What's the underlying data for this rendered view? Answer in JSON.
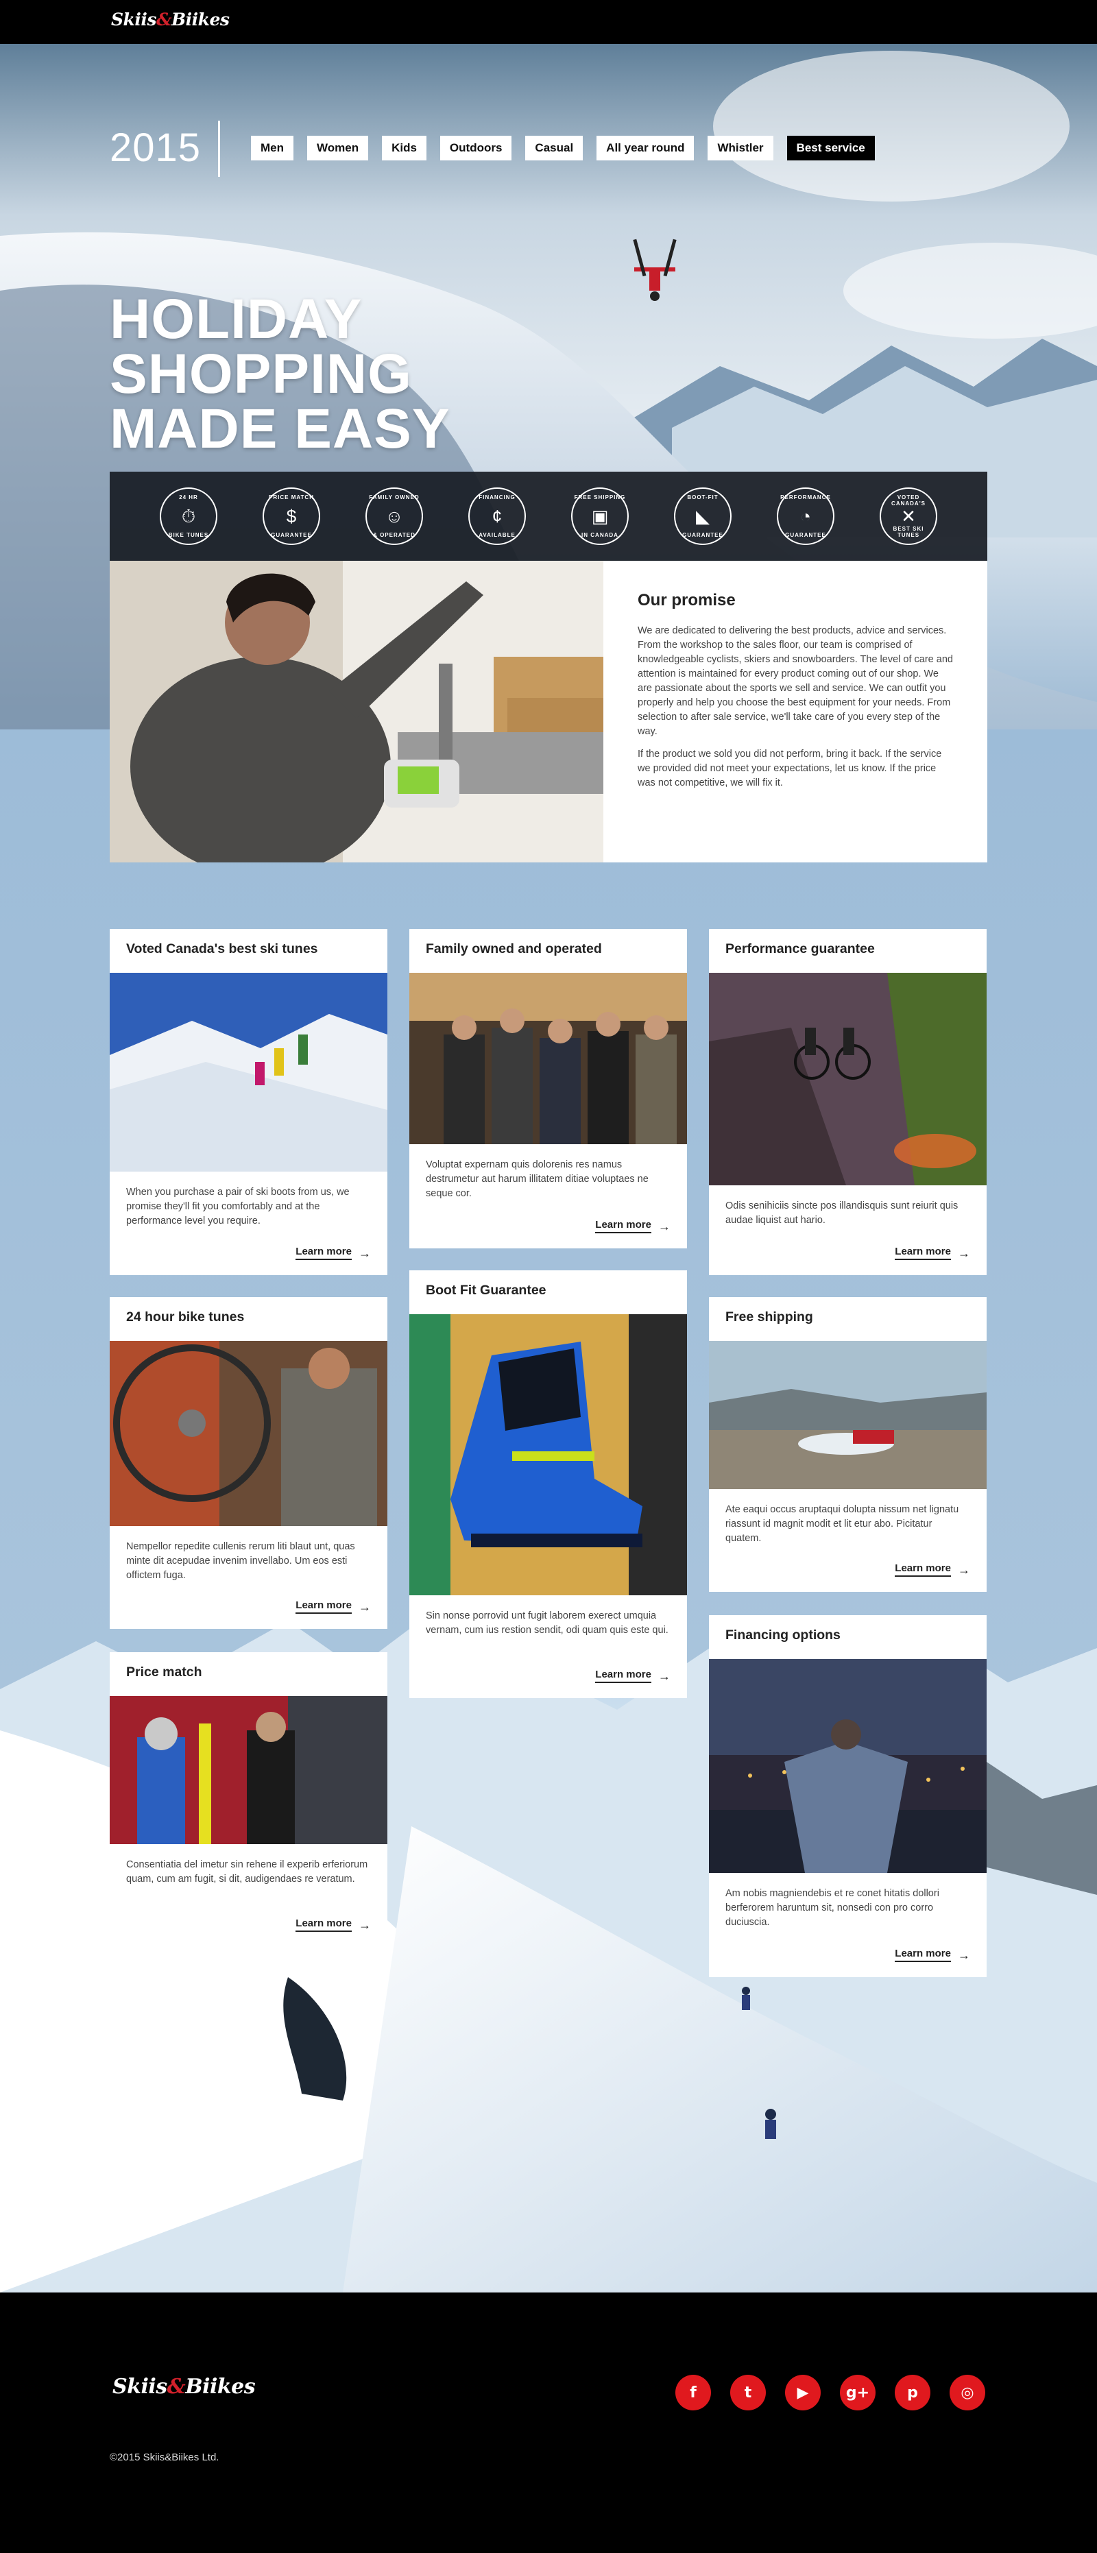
{
  "brand": {
    "logo_left": "Skiis",
    "logo_amp": "&",
    "logo_right": "Biikes"
  },
  "nav": {
    "year": "2015",
    "items": [
      {
        "label": "Men"
      },
      {
        "label": "Women"
      },
      {
        "label": "Kids"
      },
      {
        "label": "Outdoors"
      },
      {
        "label": "Casual"
      },
      {
        "label": "All year round"
      },
      {
        "label": "Whistler"
      },
      {
        "label": "Best service",
        "active": true
      }
    ]
  },
  "hero": {
    "lines": [
      "HOLIDAY",
      "SHOPPING",
      "MADE EASY"
    ]
  },
  "badges": [
    {
      "top": "24 hr",
      "bottom": "bike tunes",
      "icon": "stopwatch-icon",
      "glyph": "⏱"
    },
    {
      "top": "price match",
      "bottom": "guarantee",
      "icon": "price-tag-icon",
      "glyph": "$"
    },
    {
      "top": "family owned",
      "bottom": "& operated",
      "icon": "family-icon",
      "glyph": "☺"
    },
    {
      "top": "financing",
      "bottom": "available",
      "icon": "piggy-bank-icon",
      "glyph": "¢"
    },
    {
      "top": "free shipping",
      "bottom": "in canada",
      "icon": "box-icon",
      "glyph": "▣"
    },
    {
      "top": "boot-fit",
      "bottom": "guarantee",
      "icon": "boot-icon",
      "glyph": "◣"
    },
    {
      "top": "performance",
      "bottom": "guarantee",
      "icon": "gauge-icon",
      "glyph": "◔"
    },
    {
      "top": "voted canada's",
      "bottom": "best ski tunes",
      "icon": "skis-icon",
      "glyph": "✕"
    }
  ],
  "promise": {
    "title": "Our promise",
    "para1": "We are dedicated to delivering the best products, advice and services. From the workshop to the sales floor, our team is comprised of knowledgeable cyclists, skiers and snowboarders. The level of care and attention is maintained for every product coming out of our shop. We are passionate about the sports we sell and service. We can outfit you properly and help you choose the best equipment for your needs. From selection to after sale service, we'll take care of you every step of the way.",
    "para2": "If the product we sold you did not perform, bring it back. If the service we provided did not meet your expectations, let us know. If the price was not competitive, we will fix it."
  },
  "cards": [
    {
      "title": "Voted Canada's best ski tunes",
      "text": "When you purchase a pair of ski boots from us, we promise they'll fit you comfortably and at the performance level you require.",
      "link": "Learn more"
    },
    {
      "title": "Family owned and operated",
      "text": "Voluptat expernam quis dolorenis res namus destrumetur aut harum illitatem ditiae voluptaes ne seque cor.",
      "link": "Learn more"
    },
    {
      "title": "Performance guarantee",
      "text": "Odis senihiciis sincte pos illandisquis sunt reiurit quis audae liquist aut hario.",
      "link": "Learn more"
    },
    {
      "title": "24 hour bike tunes",
      "text": "Nempellor repedite cullenis rerum liti blaut unt, quas minte dit acepudae invenim invellabo. Um eos esti offictem fuga.",
      "link": "Learn more"
    },
    {
      "title": "Boot Fit Guarantee",
      "text": "Sin nonse porrovid unt fugit laborem exerect umquia vernam, cum ius restion sendit, odi quam quis este qui.",
      "link": "Learn more"
    },
    {
      "title": "Free shipping",
      "text": "Ate eaqui occus aruptaqui dolupta nissum net lignatu riassunt id magnit modit et lit etur abo. Picitatur quatem.",
      "link": "Learn more"
    },
    {
      "title": "Price match",
      "text": "Consentiatia del imetur sin rehene il experib erferiorum quam, cum am fugit, si dit, audigendaes re veratum.",
      "link": "Learn more"
    },
    {
      "title": "Financing options",
      "text": "Am nobis magniendebis et re conet hitatis dollori berferorem haruntum sit, nonsedi con pro corro duciuscia.",
      "link": "Learn more"
    }
  ],
  "footer": {
    "socials": [
      {
        "icon": "facebook-icon",
        "glyph": "f"
      },
      {
        "icon": "twitter-icon",
        "glyph": "t"
      },
      {
        "icon": "youtube-icon",
        "glyph": "▶"
      },
      {
        "icon": "google-plus-icon",
        "glyph": "g+"
      },
      {
        "icon": "pinterest-icon",
        "glyph": "p"
      },
      {
        "icon": "instagram-icon",
        "glyph": "◎"
      }
    ],
    "copyright": "©2015 Skiis&Biikes Ltd."
  },
  "colors": {
    "brand_red": "#d2212b",
    "social_red": "#e0191e",
    "black": "#000000",
    "sky": "#a9c6df"
  }
}
